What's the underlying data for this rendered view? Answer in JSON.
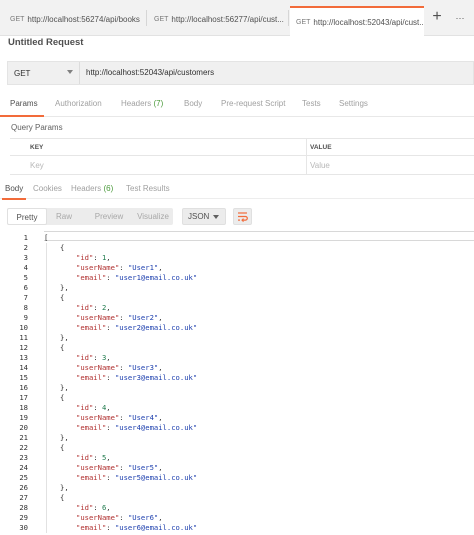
{
  "tabs": [
    {
      "method": "GET",
      "url": "http://localhost:56274/api/books",
      "unsaved": true,
      "active": false
    },
    {
      "method": "GET",
      "url": "http://localhost:56277/api/cust...",
      "unsaved": true,
      "active": false
    },
    {
      "method": "GET",
      "url": "http://localhost:52043/api/cust...",
      "unsaved": false,
      "active": true,
      "close": "×"
    }
  ],
  "tab_add": "+",
  "tab_more": "···",
  "request_title": "Untitled Request",
  "request": {
    "method": "GET",
    "url": "http://localhost:52043/api/customers"
  },
  "request_tabs": {
    "params": "Params",
    "authorization": "Authorization",
    "headers": "Headers",
    "headers_count": "(7)",
    "body": "Body",
    "prerequest": "Pre-request Script",
    "tests": "Tests",
    "settings": "Settings"
  },
  "query_params": {
    "label": "Query Params",
    "key_header": "KEY",
    "value_header": "VALUE",
    "key_placeholder": "Key",
    "value_placeholder": "Value"
  },
  "response_tabs": {
    "body": "Body",
    "cookies": "Cookies",
    "headers": "Headers",
    "headers_count": "(6)",
    "test_results": "Test Results"
  },
  "view_modes": {
    "pretty": "Pretty",
    "raw": "Raw",
    "preview": "Preview",
    "visualize": "Visualize"
  },
  "format": "JSON",
  "response_lines": [
    {
      "n": "1",
      "indent": 0,
      "text": "["
    },
    {
      "n": "2",
      "indent": 1,
      "text": "{"
    },
    {
      "n": "3",
      "indent": 2,
      "key": "\"id\"",
      "num": "1"
    },
    {
      "n": "4",
      "indent": 2,
      "key": "\"userName\"",
      "str": "\"User1\""
    },
    {
      "n": "5",
      "indent": 2,
      "key": "\"email\"",
      "str": "\"user1@email.co.uk\"",
      "last": true
    },
    {
      "n": "6",
      "indent": 1,
      "text": "},"
    },
    {
      "n": "7",
      "indent": 1,
      "text": "{"
    },
    {
      "n": "8",
      "indent": 2,
      "key": "\"id\"",
      "num": "2"
    },
    {
      "n": "9",
      "indent": 2,
      "key": "\"userName\"",
      "str": "\"User2\""
    },
    {
      "n": "10",
      "indent": 2,
      "key": "\"email\"",
      "str": "\"user2@email.co.uk\"",
      "last": true
    },
    {
      "n": "11",
      "indent": 1,
      "text": "},"
    },
    {
      "n": "12",
      "indent": 1,
      "text": "{"
    },
    {
      "n": "13",
      "indent": 2,
      "key": "\"id\"",
      "num": "3"
    },
    {
      "n": "14",
      "indent": 2,
      "key": "\"userName\"",
      "str": "\"User3\""
    },
    {
      "n": "15",
      "indent": 2,
      "key": "\"email\"",
      "str": "\"user3@email.co.uk\"",
      "last": true
    },
    {
      "n": "16",
      "indent": 1,
      "text": "},"
    },
    {
      "n": "17",
      "indent": 1,
      "text": "{"
    },
    {
      "n": "18",
      "indent": 2,
      "key": "\"id\"",
      "num": "4"
    },
    {
      "n": "19",
      "indent": 2,
      "key": "\"userName\"",
      "str": "\"User4\""
    },
    {
      "n": "20",
      "indent": 2,
      "key": "\"email\"",
      "str": "\"user4@email.co.uk\"",
      "last": true
    },
    {
      "n": "21",
      "indent": 1,
      "text": "},"
    },
    {
      "n": "22",
      "indent": 1,
      "text": "{"
    },
    {
      "n": "23",
      "indent": 2,
      "key": "\"id\"",
      "num": "5"
    },
    {
      "n": "24",
      "indent": 2,
      "key": "\"userName\"",
      "str": "\"User5\""
    },
    {
      "n": "25",
      "indent": 2,
      "key": "\"email\"",
      "str": "\"user5@email.co.uk\"",
      "last": true
    },
    {
      "n": "26",
      "indent": 1,
      "text": "},"
    },
    {
      "n": "27",
      "indent": 1,
      "text": "{"
    },
    {
      "n": "28",
      "indent": 2,
      "key": "\"id\"",
      "num": "6"
    },
    {
      "n": "29",
      "indent": 2,
      "key": "\"userName\"",
      "str": "\"User6\""
    },
    {
      "n": "30",
      "indent": 2,
      "key": "\"email\"",
      "str": "\"user6@email.co.uk\"",
      "last": true
    }
  ],
  "colors": {
    "accent": "#f26b3a",
    "json_key": "#b03030",
    "json_string": "#1d3fae",
    "json_number": "#1f7a4c",
    "headers_badge": "#4a9a3a"
  },
  "icons": {
    "unsaved_dot": "dot-icon",
    "method_dropdown": "chevron-down-icon",
    "format_dropdown": "chevron-down-icon",
    "wrap": "wrap-lines-icon"
  }
}
